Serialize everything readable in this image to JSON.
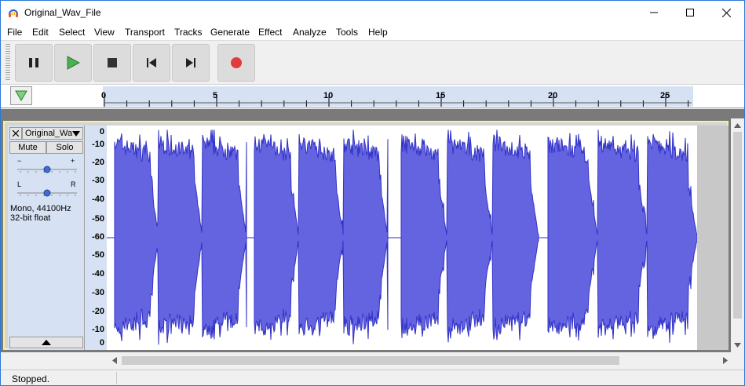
{
  "window": {
    "title": "Original_Wav_File"
  },
  "menu": [
    {
      "label": "File"
    },
    {
      "label": "Edit"
    },
    {
      "label": "Select"
    },
    {
      "label": "View"
    },
    {
      "label": "Transport"
    },
    {
      "label": "Tracks"
    },
    {
      "label": "Generate"
    },
    {
      "label": "Effect"
    },
    {
      "label": "Analyze"
    },
    {
      "label": "Tools"
    },
    {
      "label": "Help"
    }
  ],
  "toolbar": {
    "buttons": [
      "pause-icon",
      "play-icon",
      "stop-icon",
      "skip-to-start-icon",
      "skip-to-end-icon",
      "record-icon"
    ]
  },
  "ruler": {
    "ticks": [
      "0",
      "5",
      "10",
      "15",
      "20",
      "25"
    ]
  },
  "track": {
    "name": "Original_Wa",
    "mute_label": "Mute",
    "solo_label": "Solo",
    "gain_minus": "−",
    "gain_plus": "+",
    "pan_left": "L",
    "pan_right": "R",
    "info_line1": "Mono, 44100Hz",
    "info_line2": "32-bit float",
    "scale_labels": [
      "0",
      "-10",
      "-20",
      "-30",
      "-40",
      "-50",
      "-60",
      "-50",
      "-40",
      "-30",
      "-20",
      "-10",
      "0"
    ]
  },
  "status": {
    "text": "Stopped."
  },
  "colors": {
    "waveform": "#6464e0",
    "waveform_edge": "#3232c8",
    "record": "#e03c3c",
    "play": "#4caf50"
  }
}
